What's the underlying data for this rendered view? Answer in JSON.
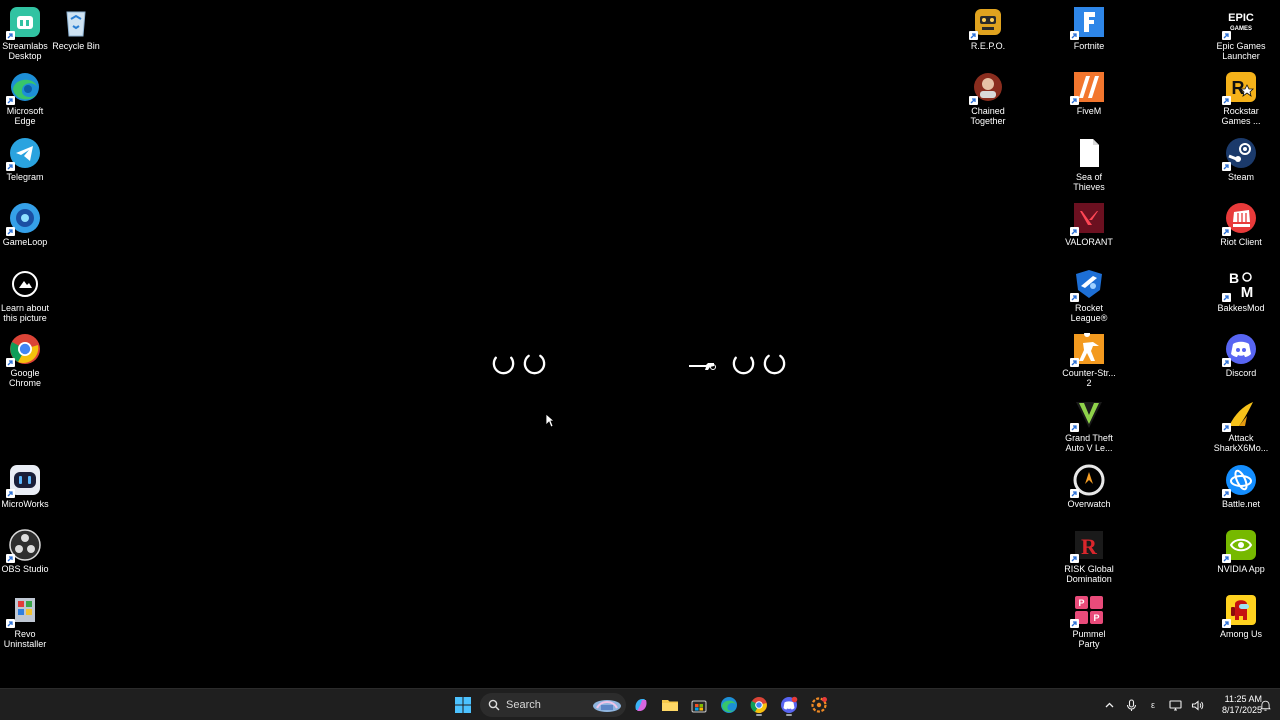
{
  "desktop": {
    "left_icons": [
      {
        "label": "Streamlabs\nDesktop",
        "icon": "streamlabs-icon",
        "shortcut": true
      },
      {
        "label": "Recycle Bin",
        "icon": "recycle-bin-icon",
        "shortcut": false
      },
      {
        "label": "Microsoft\nEdge",
        "icon": "edge-icon",
        "shortcut": true
      },
      {
        "label": "Telegram",
        "icon": "telegram-icon",
        "shortcut": true
      },
      {
        "label": "GameLoop",
        "icon": "gameloop-icon",
        "shortcut": true
      },
      {
        "label": "Learn about\nthis picture",
        "icon": "learn-picture-icon",
        "shortcut": false
      },
      {
        "label": "Google\nChrome",
        "icon": "chrome-icon",
        "shortcut": true
      },
      {
        "label": "MicroWorks",
        "icon": "microworks-icon",
        "shortcut": true
      },
      {
        "label": "OBS Studio",
        "icon": "obs-icon",
        "shortcut": true
      },
      {
        "label": "Revo\nUninstaller",
        "icon": "revo-uninstaller-icon",
        "shortcut": true
      }
    ],
    "right_icons": [
      {
        "label": "R.E.P.O.",
        "icon": "repo-icon",
        "shortcut": true
      },
      {
        "label": "Fortnite",
        "icon": "fortnite-icon",
        "shortcut": true
      },
      {
        "label": "Epic Games\nLauncher",
        "icon": "epic-games-icon",
        "shortcut": true
      },
      {
        "label": "Chained\nTogether",
        "icon": "chained-together-icon",
        "shortcut": true
      },
      {
        "label": "FiveM",
        "icon": "fivem-icon",
        "shortcut": true
      },
      {
        "label": "Rockstar\nGames ...",
        "icon": "rockstar-icon",
        "shortcut": true
      },
      {
        "label": "Sea of\nThieves",
        "icon": "sea-of-thieves-icon",
        "shortcut": false
      },
      {
        "label": "Steam",
        "icon": "steam-icon",
        "shortcut": true
      },
      {
        "label": "VALORANT",
        "icon": "valorant-icon",
        "shortcut": true
      },
      {
        "label": "Riot Client",
        "icon": "riot-client-icon",
        "shortcut": true
      },
      {
        "label": "Rocket\nLeague®",
        "icon": "rocket-league-icon",
        "shortcut": true
      },
      {
        "label": "BakkesMod",
        "icon": "bakkesmod-icon",
        "shortcut": true
      },
      {
        "label": "Counter-Str...\n2",
        "icon": "counter-strike-icon",
        "shortcut": true
      },
      {
        "label": "Discord",
        "icon": "discord-icon",
        "shortcut": true
      },
      {
        "label": "Grand Theft\nAuto V Le...",
        "icon": "gta-v-icon",
        "shortcut": true
      },
      {
        "label": "Attack\nSharkX6Mo...",
        "icon": "attack-shark-icon",
        "shortcut": true
      },
      {
        "label": "Overwatch",
        "icon": "overwatch-icon",
        "shortcut": true
      },
      {
        "label": "Battle.net",
        "icon": "battlenet-icon",
        "shortcut": true
      },
      {
        "label": "RISK Global\nDomination",
        "icon": "risk-icon",
        "shortcut": true
      },
      {
        "label": "NVIDIA App",
        "icon": "nvidia-icon",
        "shortcut": true
      },
      {
        "label": "Pummel\nParty",
        "icon": "pummel-party-icon",
        "shortcut": true
      },
      {
        "label": "Among Us",
        "icon": "among-us-icon",
        "shortcut": true
      }
    ]
  },
  "taskbar": {
    "search_placeholder": "Search",
    "pinned": [
      "start-icon",
      "copilot-icon",
      "file-explorer-icon",
      "store-icon",
      "edge-icon",
      "chrome-icon",
      "discord-icon",
      "steelseries-icon"
    ],
    "tray": {
      "language": "ε",
      "time": "11:25 AM",
      "date": "8/17/2025"
    }
  },
  "colors": {
    "taskbar_bg": "#1f1f1f",
    "desktop_bg": "#000000",
    "accent": "#3b8eea"
  }
}
